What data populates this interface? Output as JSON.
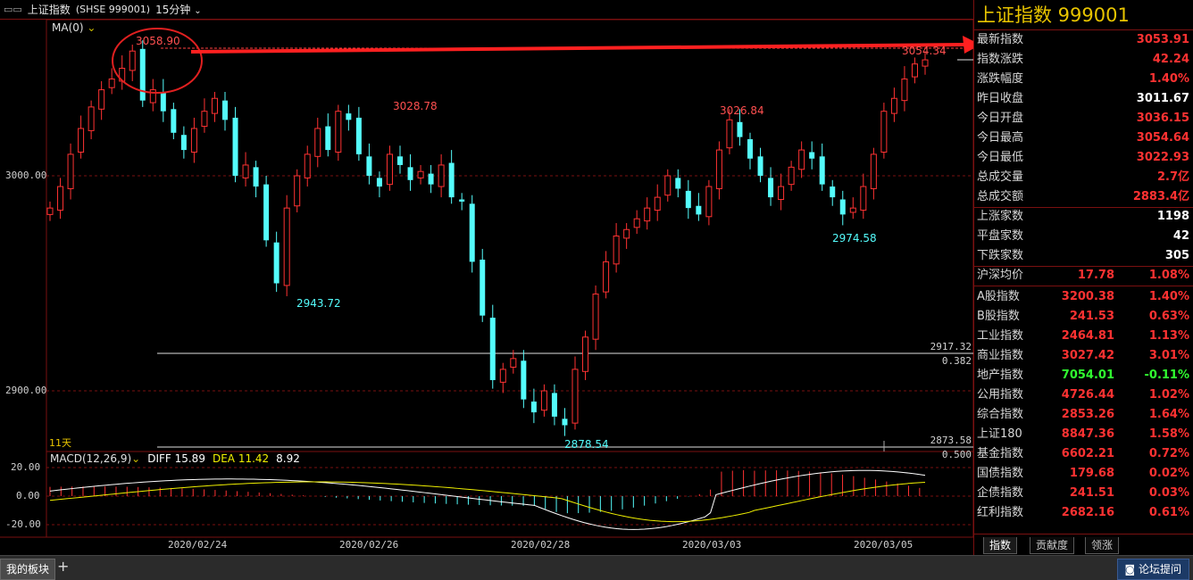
{
  "header": {
    "title": "上证指数",
    "code_label": "(SHSE 999001)",
    "period": "15分钟"
  },
  "chart": {
    "ma_label": "MA(0)",
    "price_axis": [
      "3000.00",
      "2900.00"
    ],
    "annotations": {
      "high1": "3058.90",
      "low1": "2943.72",
      "high2": "3028.78",
      "low2": "2878.54",
      "high3": "3026.84",
      "low3": "2974.58",
      "high4": "3054.34"
    },
    "fib": {
      "level1_value": "2917.32",
      "level1_ratio": "0.382",
      "level2_value": "2873.58",
      "level2_ratio": "0.500"
    },
    "days_label": "11天",
    "macd": {
      "label": "MACD(12,26,9)",
      "diff_label": "DIFF 15.89",
      "dea_label": "DEA 11.42",
      "macd_value": "8.92",
      "axis": [
        "20.00",
        "0.00",
        "-20.00"
      ]
    },
    "dates": [
      "2020/02/24",
      "2020/02/26",
      "2020/02/28",
      "2020/03/03",
      "2020/03/05"
    ]
  },
  "chart_data": {
    "type": "candlestick",
    "title": "上证指数 (SHSE 999001) 15分钟",
    "y_ticks": [
      3000.0,
      2900.0
    ],
    "x_ticks": [
      "2020/02/24",
      "2020/02/26",
      "2020/02/28",
      "2020/03/03",
      "2020/03/05"
    ],
    "marked_prices": [
      3058.9,
      2943.72,
      3028.78,
      2878.54,
      3026.84,
      2974.58,
      3054.34
    ],
    "fibonacci": [
      {
        "ratio": 0.382,
        "price": 2917.32
      },
      {
        "ratio": 0.5,
        "price": 2873.58
      }
    ],
    "macd": {
      "params": "12,26,9",
      "DIFF": 15.89,
      "DEA": 11.42,
      "MACD": 8.92,
      "y_ticks": [
        20.0,
        0.0,
        -20.0
      ]
    },
    "series": [
      {
        "name": "close",
        "values": [
          2985,
          2995,
          3010,
          3022,
          3032,
          3040,
          3045,
          3050,
          3058,
          3035,
          3040,
          3030,
          3020,
          3012,
          3022,
          3030,
          3036,
          3026,
          3000,
          3005,
          2995,
          2970,
          2950,
          2985,
          3000,
          3010,
          3022,
          3012,
          3030,
          3026,
          3010,
          3000,
          2995,
          3010,
          3005,
          2998,
          3002,
          2996,
          3005,
          2990,
          2988,
          2960,
          2935,
          2905,
          2910,
          2915,
          2896,
          2890,
          2900,
          2888,
          2884,
          2910,
          2925,
          2945,
          2960,
          2972,
          2975,
          2980,
          2985,
          2990,
          3000,
          2994,
          2985,
          2982,
          2995,
          3012,
          3026,
          3018,
          3008,
          3000,
          2990,
          2995,
          3004,
          3012,
          3008,
          2996,
          2990,
          2982,
          2985,
          2995,
          3010,
          3030,
          3036,
          3045,
          3052,
          3053.91
        ]
      }
    ],
    "colors": {
      "up": "#ff3232",
      "down": "#54fcfc",
      "diff": "#ffffff",
      "dea": "#f0f000"
    }
  },
  "panel": {
    "title": "上证指数  999001",
    "rows": [
      {
        "label": "最新指数",
        "value": "3053.91",
        "color": "#ff3232"
      },
      {
        "label": "指数涨跌",
        "value": "42.24",
        "color": "#ff3232"
      },
      {
        "label": "涨跌幅度",
        "value": "1.40%",
        "color": "#ff3232"
      },
      {
        "label": "昨日收盘",
        "value": "3011.67",
        "color": "#ffffff"
      },
      {
        "label": "今日开盘",
        "value": "3036.15",
        "color": "#ff3232"
      },
      {
        "label": "今日最高",
        "value": "3054.64",
        "color": "#ff3232"
      },
      {
        "label": "今日最低",
        "value": "3022.93",
        "color": "#ff3232"
      },
      {
        "label": "总成交量",
        "value": "2.7亿",
        "color": "#ff3232"
      },
      {
        "label": "总成交额",
        "value": "2883.4亿",
        "color": "#ff3232"
      }
    ],
    "rows2": [
      {
        "label": "上涨家数",
        "value": "1198",
        "color": "#ffffff"
      },
      {
        "label": "平盘家数",
        "value": "42",
        "color": "#ffffff"
      },
      {
        "label": "下跌家数",
        "value": "305",
        "color": "#ffffff"
      }
    ],
    "avg": {
      "label": "沪深均价",
      "v1": "17.78",
      "v2": "1.08%",
      "color": "#ff3232"
    },
    "indices": [
      {
        "label": "A股指数",
        "v1": "3200.38",
        "v2": "1.40%",
        "color": "#ff3232"
      },
      {
        "label": "B股指数",
        "v1": "241.53",
        "v2": "0.63%",
        "color": "#ff3232"
      },
      {
        "label": "工业指数",
        "v1": "2464.81",
        "v2": "1.13%",
        "color": "#ff3232"
      },
      {
        "label": "商业指数",
        "v1": "3027.42",
        "v2": "3.01%",
        "color": "#ff3232"
      },
      {
        "label": "地产指数",
        "v1": "7054.01",
        "v2": "-0.11%",
        "color": "#30ff30"
      },
      {
        "label": "公用指数",
        "v1": "4726.44",
        "v2": "1.02%",
        "color": "#ff3232"
      },
      {
        "label": "综合指数",
        "v1": "2853.26",
        "v2": "1.64%",
        "color": "#ff3232"
      },
      {
        "label": "上证180",
        "v1": "8847.36",
        "v2": "1.58%",
        "color": "#ff3232"
      },
      {
        "label": "基金指数",
        "v1": "6602.21",
        "v2": "0.72%",
        "color": "#ff3232"
      },
      {
        "label": "国债指数",
        "v1": "179.68",
        "v2": "0.02%",
        "color": "#ff3232"
      },
      {
        "label": "企债指数",
        "v1": "241.51",
        "v2": "0.03%",
        "color": "#ff3232"
      },
      {
        "label": "红利指数",
        "v1": "2682.16",
        "v2": "0.61%",
        "color": "#ff3232"
      }
    ],
    "tabs": [
      "指数",
      "贡献度",
      "领涨"
    ]
  },
  "bottombar": {
    "my_board": "我的板块",
    "add": "+",
    "forum": "论坛提问"
  }
}
